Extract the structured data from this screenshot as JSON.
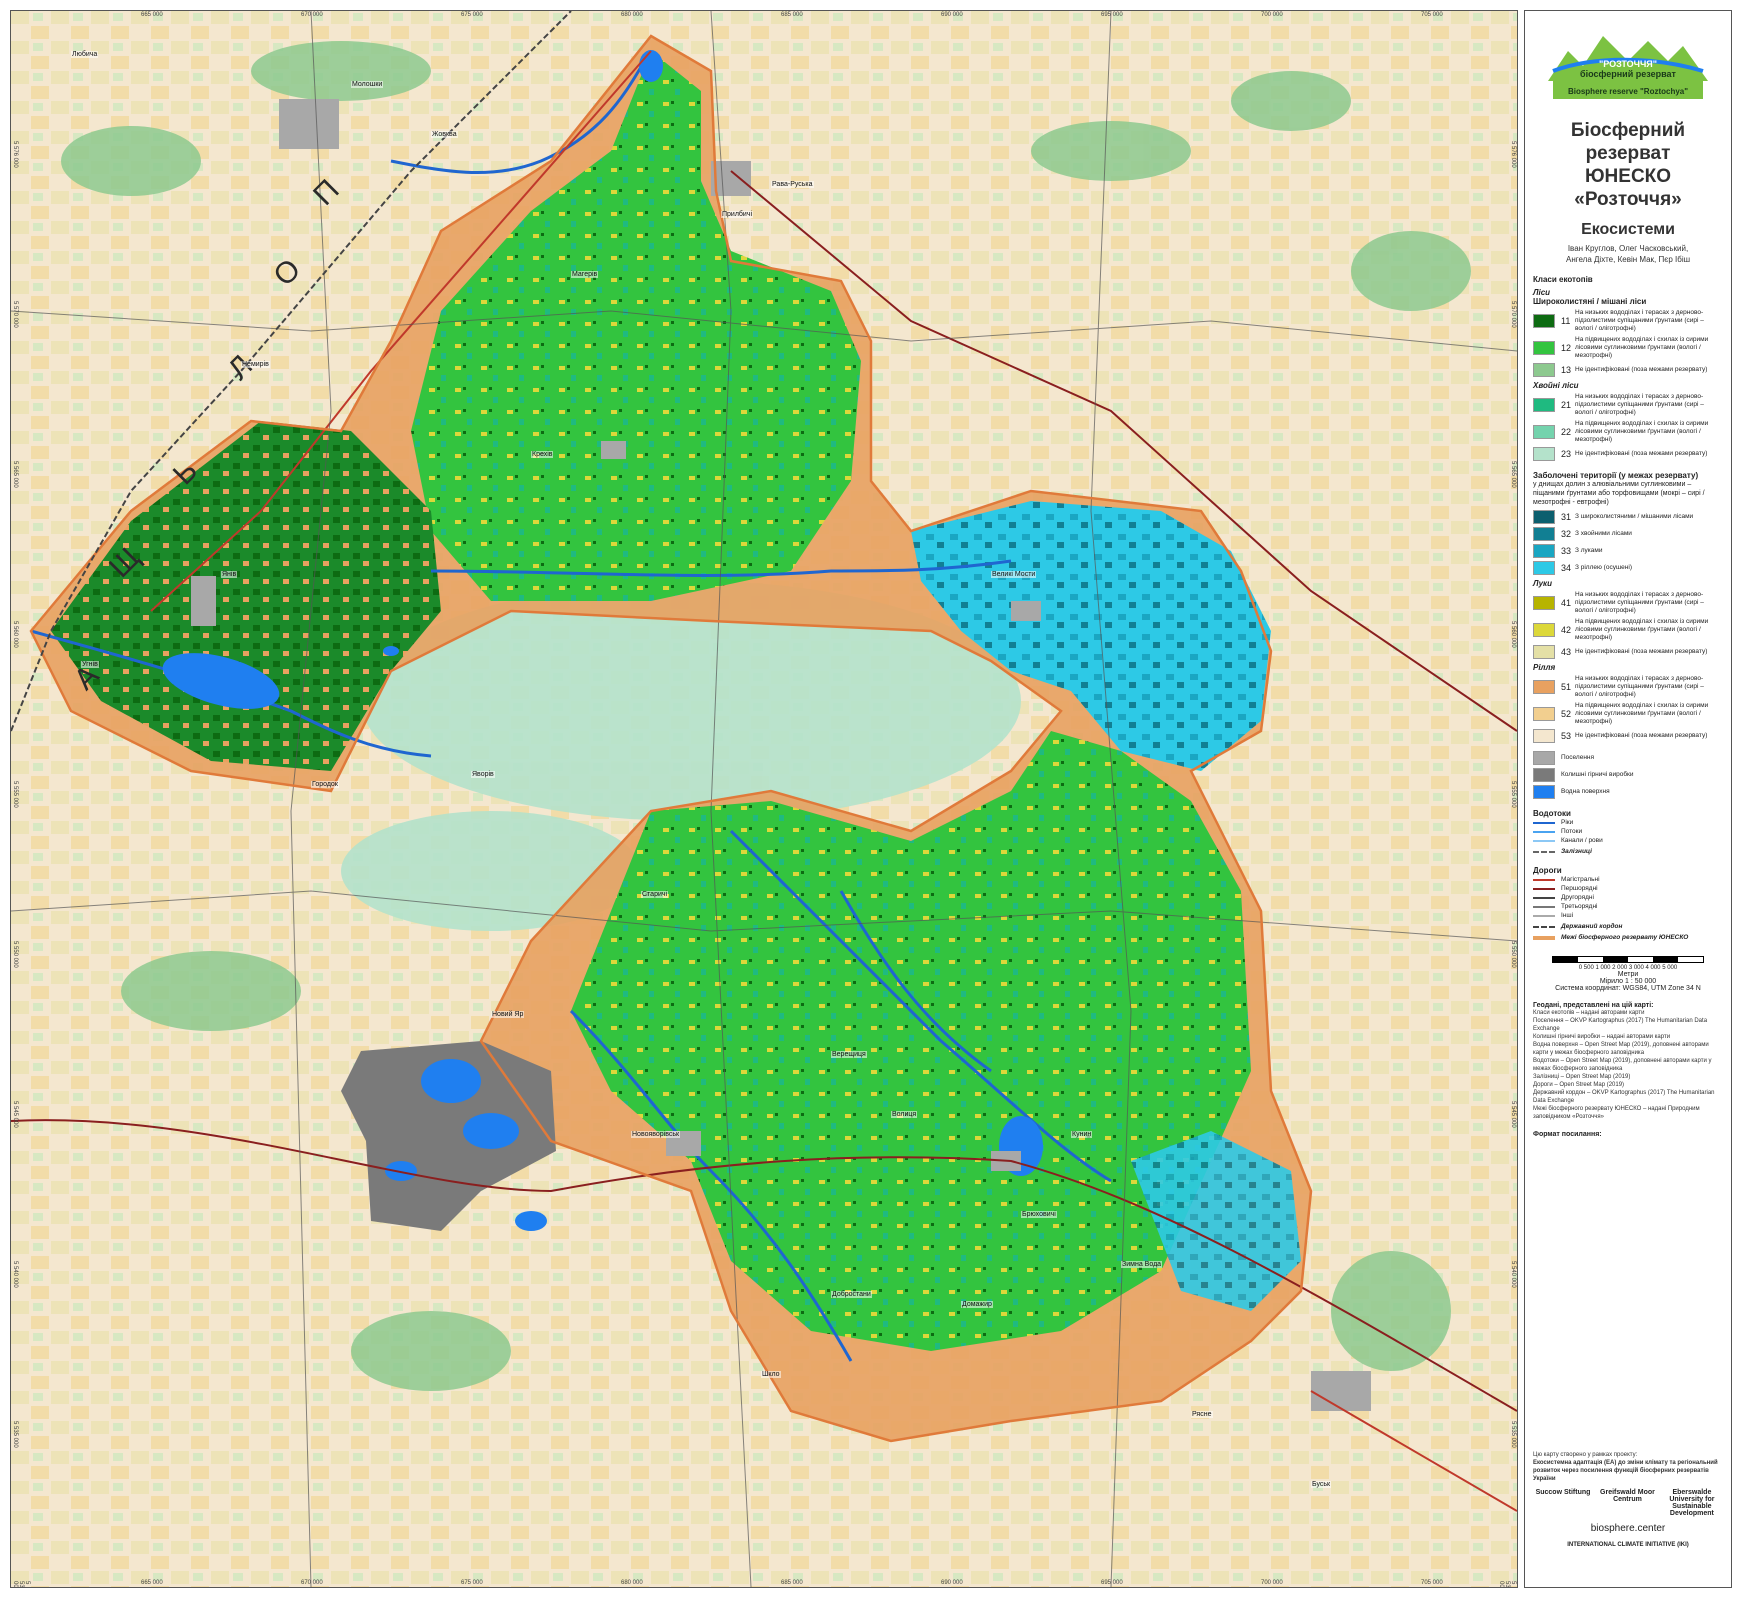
{
  "map": {
    "country_label": "ПОЛЬЩА",
    "x_ticks": [
      "665 000",
      "670 000",
      "675 000",
      "680 000",
      "685 000",
      "690 000",
      "695 000",
      "700 000",
      "705 000"
    ],
    "y_ticks": [
      "5 576 000",
      "5 570 000",
      "5 565 000",
      "5 560 000",
      "5 555 000",
      "5 550 000",
      "5 545 000",
      "5 540 000",
      "5 535 000",
      "5 530 000"
    ],
    "places": [
      "Любича",
      "Молошки",
      "Прилбичі",
      "Рава-Руська",
      "Магерів",
      "Жовква",
      "Янів",
      "Немирів",
      "Великі Мости",
      "Угнів",
      "Крехів",
      "Старичі",
      "Верещиця",
      "Новояворівськ",
      "Брюховичі",
      "Зимна Вода",
      "Новий Яр",
      "Буськ",
      "Волиця",
      "Кунин",
      "Шклo",
      "Домажир",
      "Добростани",
      "Рясне",
      "Городок",
      "Яворів"
    ]
  },
  "legend": {
    "logo": {
      "line1": "\"РОЗТОЧЧЯ\"",
      "line2": "біосферний резерват",
      "line3": "Biosphere reserve \"Roztochya\""
    },
    "title": [
      "Біосферний резерват",
      "ЮНЕСКО",
      "«Розточчя»"
    ],
    "subtitle": "Екосистеми",
    "authors": [
      "Іван Круглов, Олег Часковський,",
      "Ангела Діхте, Кевін Мак, Пєр Ібіш"
    ],
    "classes_title": "Класи екотопів",
    "forest_title": "Ліси",
    "broadleaf_title": "Широколистяні / мішані ліси",
    "broadleaf": [
      {
        "code": "11",
        "color": "#0d6b12",
        "text": "На низьких вододілах і терасах з дерново-підзолистими супіщаними ґрунтами (сирі – вологі / оліготрофні)"
      },
      {
        "code": "12",
        "color": "#33c43f",
        "text": "На підвищених вододілах і схилах із сирими лісовими суглинковими ґрунтами (вологі / мезотрофні)"
      },
      {
        "code": "13",
        "color": "#8dc98f",
        "text": "Не ідентифіковані (поза межами резервату)"
      }
    ],
    "conifer_title": "Хвойні ліси",
    "conifer": [
      {
        "code": "21",
        "color": "#1fba80",
        "text": "На низьких вододілах і терасах з дерново-підзолистими супіщаними ґрунтами (сирі – вологі / оліготрофні)"
      },
      {
        "code": "22",
        "color": "#74d3ad",
        "text": "На підвищених вододілах і схилах із сирими лісовими суглинковими ґрунтами (вологі / мезотрофні)"
      },
      {
        "code": "23",
        "color": "#b4e2cb",
        "text": "Не ідентифіковані (поза межами резервату)"
      }
    ],
    "wetland_title": "Заболочені території (у межах резервату)",
    "wetland_note": "у днищах долин з алювіальними суглинковими – піщаними ґрунтами або торфовищами (мокрі – сирі / мезотрофні - евтрофні)",
    "wetland": [
      {
        "code": "31",
        "color": "#0c5f6e",
        "text": "З широколистяними / мішаними лісами"
      },
      {
        "code": "32",
        "color": "#117f93",
        "text": "З хвойними лісами"
      },
      {
        "code": "33",
        "color": "#1aa6c2",
        "text": "З луками"
      },
      {
        "code": "34",
        "color": "#2dc9e6",
        "text": "З ріллею (осушені)"
      }
    ],
    "meadow_title": "Луки",
    "meadow": [
      {
        "code": "41",
        "color": "#b7b400",
        "text": "На низьких вододілах і терасах з дерново-підзолистими супіщаними ґрунтами (сирі – вологі / оліготрофні)"
      },
      {
        "code": "42",
        "color": "#dcd83a",
        "text": "На підвищених вододілах і схилах із сирими лісовими суглинковими ґрунтами (вологі / мезотрофні)"
      },
      {
        "code": "43",
        "color": "#e4e0a6",
        "text": "Не ідентифіковані (поза межами резервату)"
      }
    ],
    "arable_title": "Рілля",
    "arable": [
      {
        "code": "51",
        "color": "#e8a160",
        "text": "На низьких вододілах і терасах з дерново-підзолистими супіщаними ґрунтами (сирі – вологі / оліготрофні)"
      },
      {
        "code": "52",
        "color": "#f2cf8f",
        "text": "На підвищених вододілах і схилах із сирими лісовими суглинковими ґрунтами (вологі / мезотрофні)"
      },
      {
        "code": "53",
        "color": "#f4e7cf",
        "text": "Не ідентифіковані (поза межами резервату)"
      }
    ],
    "other": [
      {
        "color": "#a8a8a8",
        "text": "Поселення"
      },
      {
        "color": "#7a7a7a",
        "text": "Колишні гірничі виробки"
      },
      {
        "color": "#1f7ff0",
        "text": "Водна поверхня"
      }
    ],
    "water_title": "Водотоки",
    "water": [
      {
        "color": "#1f66d0",
        "text": "Ріки"
      },
      {
        "color": "#4aa3f0",
        "text": "Потоки"
      },
      {
        "color": "#8cc8f5",
        "text": "Канали / рови"
      }
    ],
    "rail": "Залізниці",
    "roads_title": "Дороги",
    "roads": [
      {
        "color": "#c0392b",
        "text": "Магістральні"
      },
      {
        "color": "#8a1f1f",
        "text": "Першорядні"
      },
      {
        "color": "#444444",
        "text": "Другорядні"
      },
      {
        "color": "#777777",
        "text": "Третьорядні"
      },
      {
        "color": "#aaaaaa",
        "text": "Інші"
      }
    ],
    "border": "Державний кордон",
    "reserve_border": "Межі біосферного резервату ЮНЕСКО",
    "scale_ticks": "0  500 1 000     2 000      3 000      4 000      5 000",
    "scale_unit": "Метри",
    "scale": "Мірило 1 : 50 000",
    "crs": "Система координат: WGS84, UTM Zone 34 N",
    "sources_title": "Геодані, представлені на цій карті:",
    "sources": [
      "Класи екотопів – надані авторами карти",
      "Поселення – OKVP Kartographus (2017) The Humanitarian Data Exchange",
      "Колишні гірничі виробки – надані авторами карти",
      "Водна поверхня – Open Street Map (2019), доповнені авторами карти у межах біосферного заповідника",
      "Водотоки – Open Street Map (2019), доповнені авторами карти у межах біосферного заповідника",
      "Залізниці – Open Street Map (2019)",
      "Дороги – Open Street Map (2019)",
      "Державний кордон – OKVP Kartographus (2017) The Humanitarian Data Exchange",
      "Межі біосферного резервату ЮНЕСКО – надані Природним заповідником «Розточчя»"
    ],
    "citation_title": "Формат посилання:",
    "project_note": "Цю карту створено у рамках проекту:",
    "project": "Екосистемна адаптація (ЕА) до зміни клімату та регіональний розвиток через посилення функцій біосферних резерватів України",
    "partners": [
      "Succow Stiftung",
      "Greifswald Moor Centrum",
      "Eberswalde University for Sustainable Development"
    ],
    "website": "biosphere.center",
    "iki": "INTERNATIONAL CLIMATE INITIATIVE (IKI)"
  }
}
